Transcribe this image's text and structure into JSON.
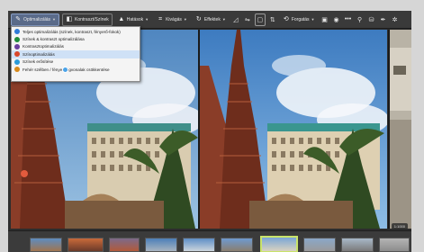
{
  "toolbar": {
    "optimize_label": "Optimalizálás",
    "contrast_label": "Kontraszt/Színek",
    "sharpen_label": "Hatások",
    "crop_label": "Kivágás",
    "effects_label": "Effektek",
    "rotate_label": "Forgatás"
  },
  "menu": {
    "items": [
      {
        "label": "Teljes optimalizálás (színek, kontraszt, fényerő-fokok)",
        "color": "#2f7bd8"
      },
      {
        "label": "Színek & kontraszt optimalizálása",
        "color": "#1f8d3a"
      },
      {
        "label": "Kontrasztoptimalizálás",
        "color": "#6b3fa0"
      },
      {
        "label": "Színoptimalizálás",
        "color": "#d9472b"
      },
      {
        "label": "Színek erősítése",
        "color": "#2b9bd9"
      },
      {
        "label": "Fehér szélben / fényességvonalak csökkentése",
        "color": "#d88a1a"
      }
    ],
    "highlighted_index": 3
  },
  "viewer": {
    "zoom_label": "1:1000"
  },
  "filmstrip": {
    "selected_index": 7
  }
}
